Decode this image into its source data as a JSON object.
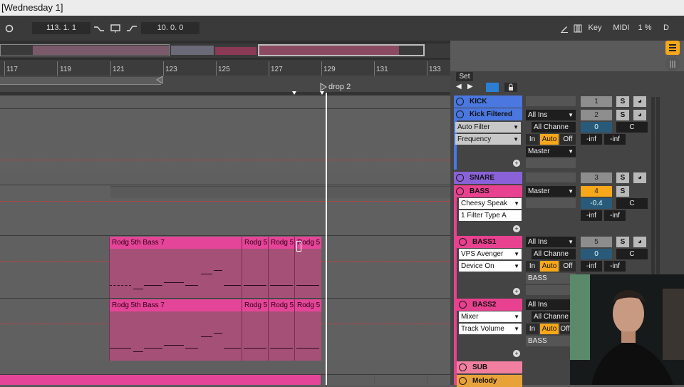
{
  "window": {
    "title": "[Wednesday 1]"
  },
  "transport": {
    "position": "113.  1.  1",
    "loop_length": "10.  0.  0",
    "key_label": "Key",
    "midi_label": "MIDI",
    "cpu": "1 %",
    "d_label": "D"
  },
  "ruler": {
    "bars": [
      "117",
      "119",
      "121",
      "123",
      "125",
      "127",
      "129",
      "131",
      "133"
    ]
  },
  "locator": {
    "name": "drop 2"
  },
  "mixer": {
    "set_label": "Set",
    "tracks": [
      {
        "name": "KICK",
        "color": "#4a77e0",
        "number": "1"
      },
      {
        "name": "Kick Filtered",
        "color": "#4a77e0",
        "number": "2",
        "input": "All Ins",
        "channel": "All Channe",
        "device": "Auto Filter",
        "param": "Frequency",
        "in": "In",
        "auto": "Auto",
        "off": "Off",
        "output": "Master",
        "pan": "0",
        "pan_c": "C",
        "vol1": "-inf",
        "vol2": "-inf"
      },
      {
        "name": "SNARE",
        "color": "#8a62d8",
        "number": "3"
      },
      {
        "name": "BASS",
        "color": "#e8418f",
        "number": "4",
        "output": "Master",
        "device": "Cheesy Speak",
        "param": "1 Filter Type A",
        "pan": "-0.4",
        "pan_c": "C",
        "vol1": "-inf",
        "vol2": "-inf"
      },
      {
        "name": "BASS1",
        "color": "#e8418f",
        "number": "5",
        "input": "All Ins",
        "channel": "All Channe",
        "device": "VPS Avenger",
        "param": "Device On",
        "in": "In",
        "auto": "Auto",
        "off": "Off",
        "output": "BASS",
        "pan": "0",
        "pan_c": "C",
        "vol1": "-inf",
        "vol2": "-inf"
      },
      {
        "name": "BASS2",
        "color": "#e8418f",
        "input": "All Ins",
        "channel": "All Channe",
        "device": "Mixer",
        "param": "Track Volume",
        "in": "In",
        "auto": "Auto",
        "off": "Off",
        "output": "BASS"
      },
      {
        "name": "SUB",
        "color": "#f07fa0"
      },
      {
        "name": "Melody",
        "color": "#e8a23a"
      }
    ],
    "solo_label": "S"
  },
  "clips": {
    "bass1": [
      "Rodg 5th Bass 7",
      "Rodg 5",
      "Rodg 5",
      "Rodg 5"
    ],
    "bass2": [
      "Rodg 5th Bass 7",
      "Rodg 5",
      "Rodg 5",
      "Rodg 5"
    ]
  },
  "colors": {
    "accent": "#f7a71a",
    "clip": "#e54598",
    "playhead": "#ffffff"
  }
}
